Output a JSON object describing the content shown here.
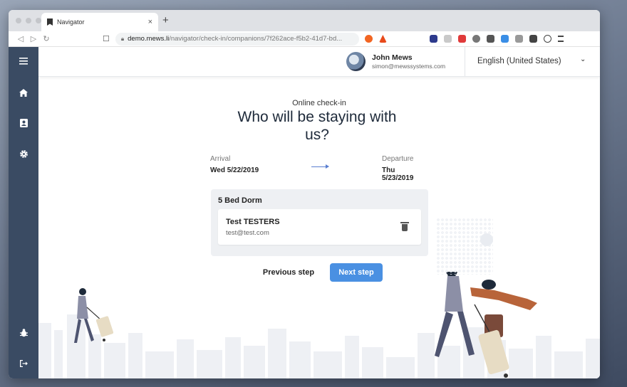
{
  "browser": {
    "tab_title": "Navigator",
    "tab_close": "×",
    "new_tab": "+",
    "url_host": "demo.mews.li",
    "url_path": "/navigator/check-in/companions/7f262ace-f5b2-41d7-bd..."
  },
  "user": {
    "name": "John Mews",
    "email": "simon@mewssystems.com"
  },
  "language": {
    "selected": "English (United States)"
  },
  "checkin": {
    "subtitle": "Online check-in",
    "title": "Who will be staying with us?",
    "arrival_label": "Arrival",
    "arrival_value": "Wed 5/22/2019",
    "departure_label": "Departure",
    "departure_value": "Thu 5/23/2019",
    "room": {
      "name": "5 Bed Dorm",
      "guests": [
        {
          "name": "Test TESTERS",
          "email": "test@test.com"
        }
      ]
    },
    "previous_label": "Previous step",
    "next_label": "Next step"
  },
  "colors": {
    "sidebar": "#3a4b63",
    "accent": "#4a90e2",
    "room_box": "#eef0f3"
  },
  "icons": {
    "sidebar_top": [
      "menu-icon",
      "home-icon",
      "contacts-icon",
      "gear-icon"
    ],
    "sidebar_bottom": [
      "bug-icon",
      "logout-icon"
    ]
  }
}
